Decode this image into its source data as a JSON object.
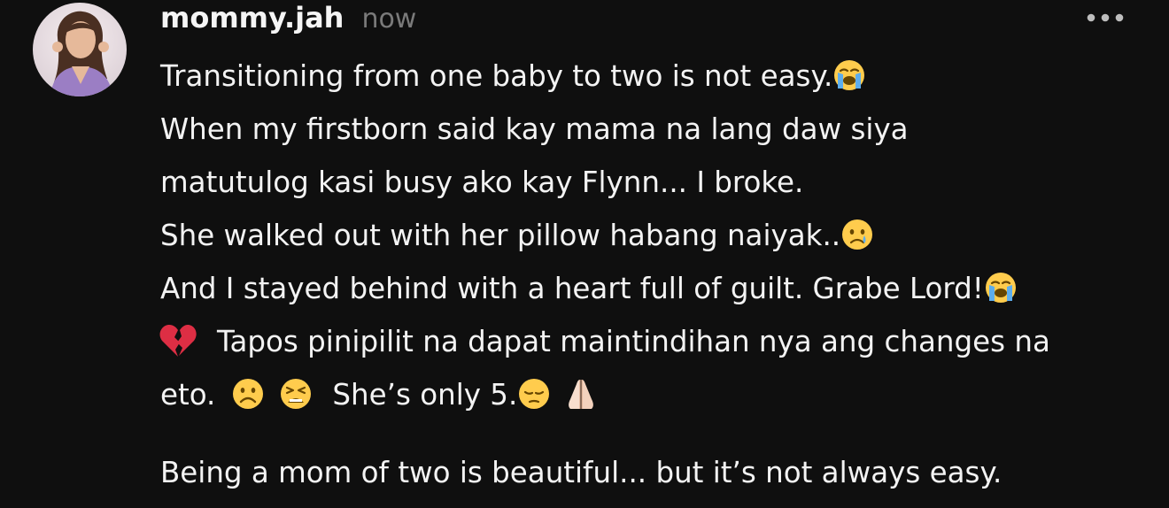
{
  "post": {
    "author": "mommy.jah",
    "timestamp": "now",
    "more_icon": "more-horizontal-icon",
    "avatar_icon": "profile-photo"
  },
  "content": {
    "lines": [
      "Transitioning from one baby to two is not easy.",
      "When my firstborn said kay mama na lang daw siya",
      "matutulog kasi busy ako kay Flynn... I broke.",
      "She walked out with her pillow habang naiyak..",
      "And I stayed behind with a heart full of guilt. Grabe Lord!",
      "Tapos pinipilit na dapat maintindihan nya ang changes na",
      "eto.",
      "She’s only 5.",
      "Being a mom of two is beautiful... but it’s not always easy."
    ],
    "emojis": {
      "line1": "loudly-crying-face",
      "line4": "crying-face",
      "line5": "loudly-crying-face",
      "line6_lead": "broken-heart",
      "line7_a": "frowning-face",
      "line7_b": "tired-face",
      "line7_c": "pensive-face",
      "line7_d": "folded-hands"
    }
  },
  "colors": {
    "background": "#0f0f0f",
    "text": "#f3f3f3",
    "muted": "#7a7a7a"
  }
}
